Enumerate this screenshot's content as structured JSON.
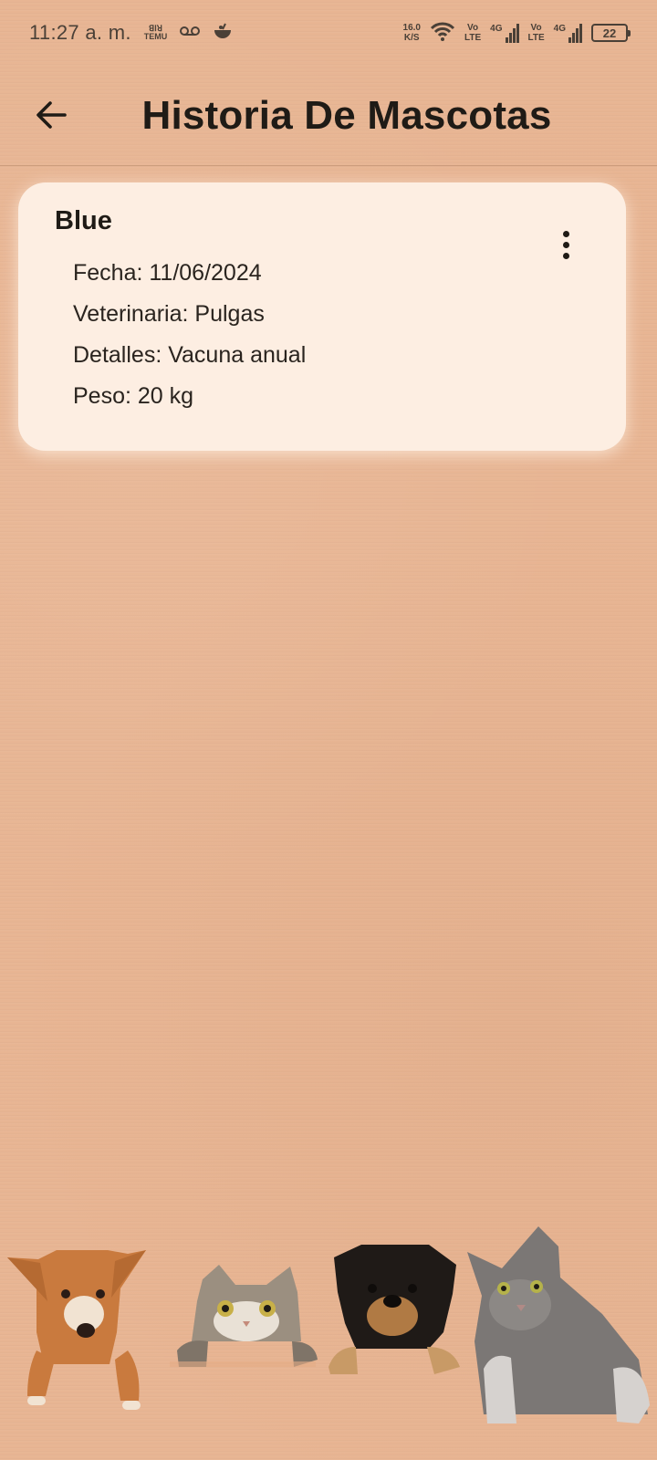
{
  "status_bar": {
    "time": "11:27 a. m.",
    "temu_label_top": "ꓭꓲꓤ",
    "temu_label": "TEMU",
    "speed_value": "16.0",
    "speed_unit": "K/S",
    "volte_1_top": "Vo",
    "volte_1_bottom": "LTE",
    "net_1": "4G",
    "volte_2_top": "Vo",
    "volte_2_bottom": "LTE",
    "net_2": "4G",
    "battery": "22"
  },
  "app_bar": {
    "title": "Historia De Mascotas",
    "back_icon": "arrow-left-icon"
  },
  "record": {
    "pet_name": "Blue",
    "fecha": "Fecha: 11/06/2024",
    "veterinaria": "Veterinaria: Pulgas",
    "detalles": "Detalles: Vacuna anual",
    "peso": "Peso: 20 kg",
    "menu_icon": "more-vert-icon"
  },
  "colors": {
    "background": "#e8b593",
    "card": "#fdeee2",
    "text": "#1f1b16"
  }
}
